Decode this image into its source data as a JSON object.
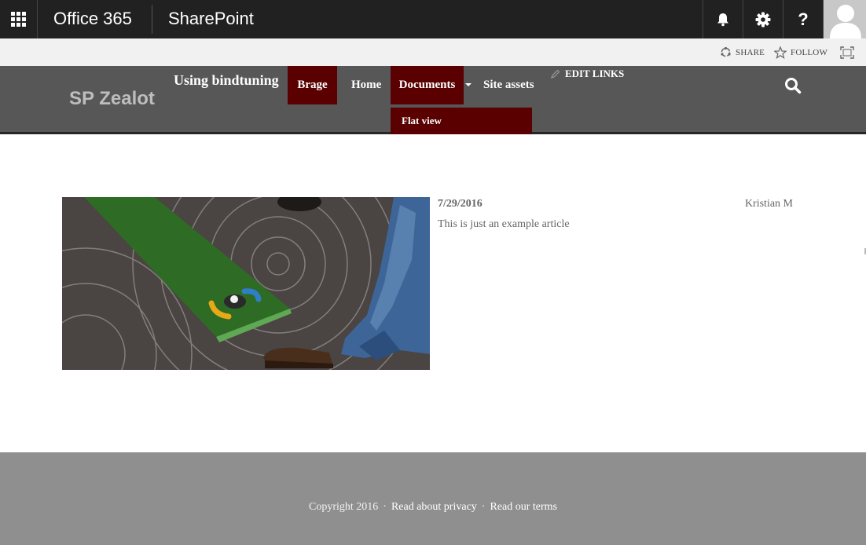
{
  "suite_bar": {
    "app_launcher_icon": "waffle-grid-icon",
    "product": "Office 365",
    "app": "SharePoint",
    "icons": [
      "bell-icon",
      "gear-icon",
      "help-icon"
    ],
    "help_glyph": "?",
    "avatar": "user-avatar"
  },
  "action_bar": {
    "share_label": "SHARE",
    "follow_label": "FOLLOW"
  },
  "site_header": {
    "title": "SP Zealot",
    "tagline": "Using bindtuning",
    "edit_links_label": "EDIT LINKS",
    "accent_color": "#5a0000"
  },
  "top_nav": {
    "items": [
      {
        "label": "Brage"
      },
      {
        "label": "Home"
      },
      {
        "label": "Documents"
      },
      {
        "label": "Site assets"
      }
    ],
    "flyout": {
      "items": [
        {
          "label": "Flat view"
        }
      ]
    }
  },
  "article": {
    "date": "7/29/2016",
    "author": "Kristian M",
    "summary": "This is just an example article"
  },
  "footer": {
    "copyright": "Copyright 2016",
    "separator": "·",
    "privacy_link": "Read about privacy",
    "terms_link": "Read our terms"
  }
}
